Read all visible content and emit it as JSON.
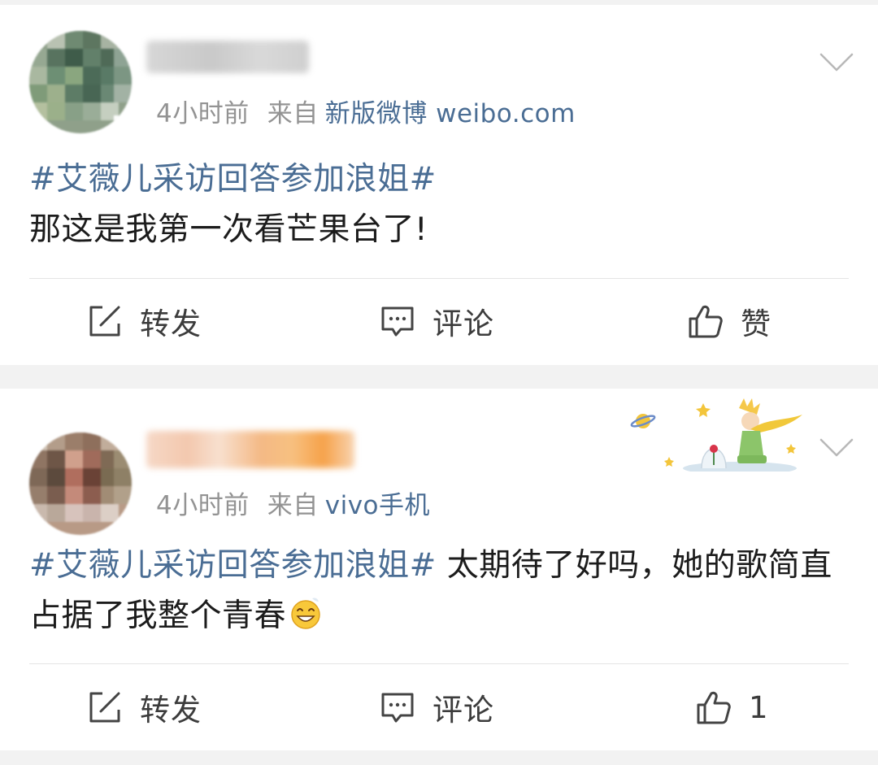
{
  "posts": [
    {
      "time": "4小时前",
      "source_prefix": "来自",
      "source": "新版微博 weibo.com",
      "hashtag": "#艾薇儿采访回答参加浪姐#",
      "text": "那这是我第一次看芒果台了!",
      "actions": {
        "repost": "转发",
        "comment": "评论",
        "like": "赞"
      }
    },
    {
      "time": "4小时前",
      "source_prefix": "来自",
      "source": "vivo手机",
      "hashtag": "#艾薇儿采访回答参加浪姐#",
      "text": " 太期待了好吗，她的歌简直占据了我整个青春",
      "actions": {
        "repost": "转发",
        "comment": "评论",
        "like": "1"
      }
    }
  ],
  "icons": {
    "repost": "edit-box-icon",
    "comment": "comment-bubble-icon",
    "like": "thumbs-up-icon",
    "menu": "chevron-down-icon",
    "emoji": "grinning-face-emoji"
  },
  "colors": {
    "link": "#4a6d94",
    "meta": "#939393",
    "text": "#1c1c1c",
    "background": "#f2f2f2"
  }
}
